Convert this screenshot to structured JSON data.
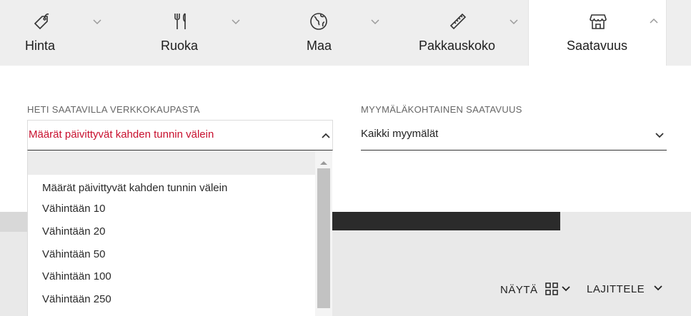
{
  "tabs": [
    {
      "label": "Hinta",
      "icon": "price-tag-icon",
      "expanded": false
    },
    {
      "label": "Ruoka",
      "icon": "fork-knife-icon",
      "expanded": false
    },
    {
      "label": "Maa",
      "icon": "globe-icon",
      "expanded": false
    },
    {
      "label": "Pakkauskoko",
      "icon": "ruler-icon",
      "expanded": false
    },
    {
      "label": "Saatavuus",
      "icon": "store-icon",
      "expanded": true
    }
  ],
  "filters": {
    "online": {
      "label": "HETI SAATAVILLA VERKKOKAUPASTA",
      "value": "Määrät päivittyvät kahden tunnin välein",
      "open": true,
      "options": [
        "",
        "Määrät päivittyvät kahden tunnin välein",
        "Vähintään 10",
        "Vähintään 20",
        "Vähintään 50",
        "Vähintään 100",
        "Vähintään 250"
      ]
    },
    "store": {
      "label": "MYYMÄLÄKOHTAINEN SAATAVUUS",
      "value": "Kaikki myymälät",
      "open": false
    }
  },
  "toolbar": {
    "show_label": "NÄYTÄ",
    "sort_label": "LAJITTELE"
  },
  "colors": {
    "accent_red": "#c8102e",
    "tab_bg": "#eeeeee",
    "dark_bar": "#2b2b2b"
  }
}
